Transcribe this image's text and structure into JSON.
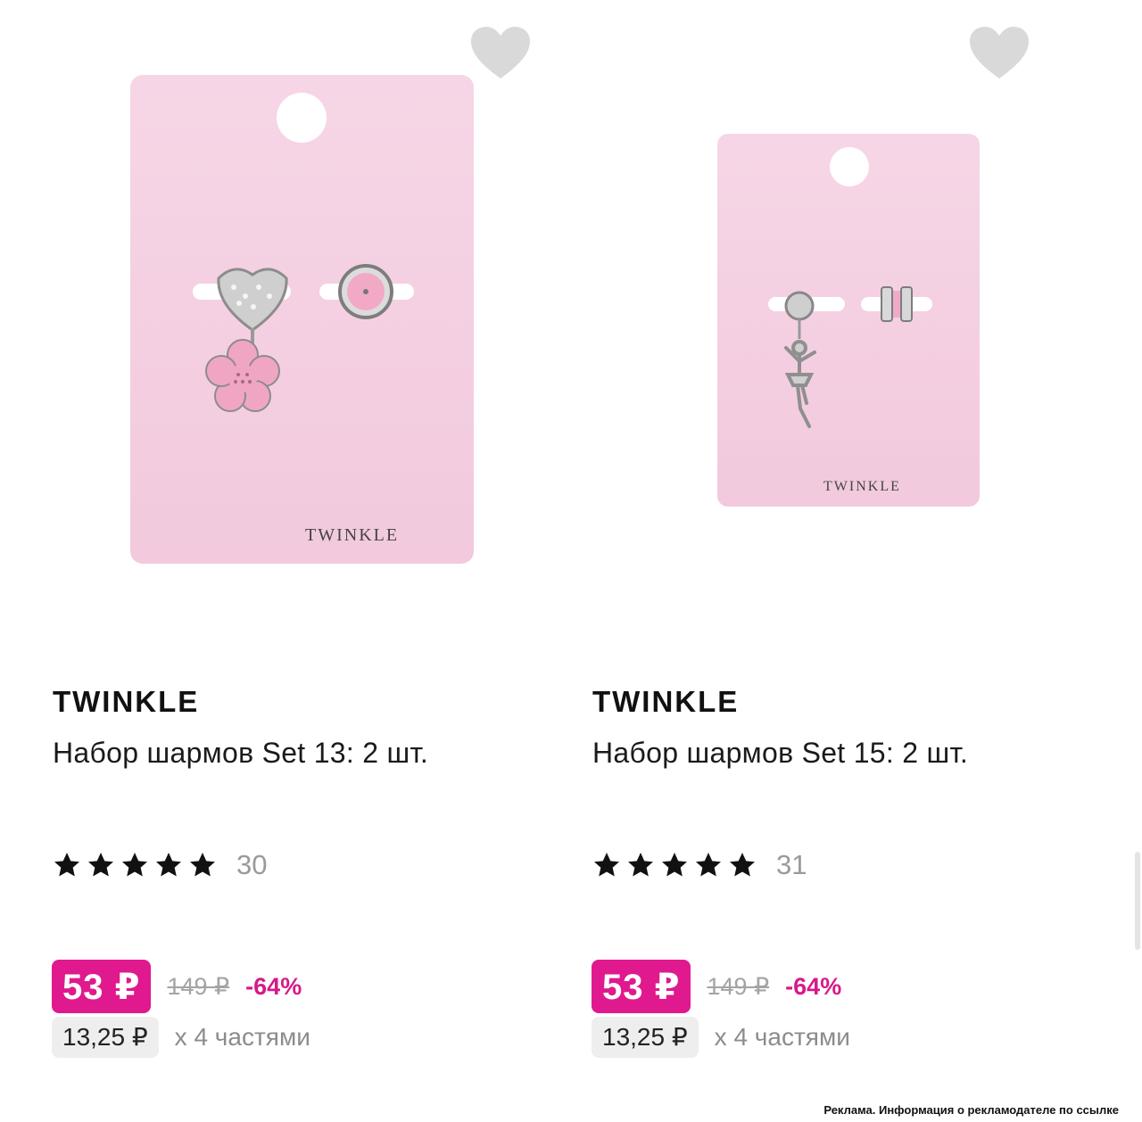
{
  "products": [
    {
      "brand": "TWINKLE",
      "title": "Набор шармов Set 13: 2 шт.",
      "card_logo": "TWINKLE",
      "rating_stars": 5,
      "reviews": "30",
      "price": "53 ₽",
      "old_price": "149 ₽",
      "discount": "-64%",
      "installment_price": "13,25 ₽",
      "installment_text": "х 4 частями"
    },
    {
      "brand": "TWINKLE",
      "title": "Набор шармов Set 15: 2 шт.",
      "card_logo": "TWINKLE",
      "rating_stars": 5,
      "reviews": "31",
      "price": "53 ₽",
      "old_price": "149 ₽",
      "discount": "-64%",
      "installment_price": "13,25 ₽",
      "installment_text": "х 4 частями"
    }
  ],
  "ad_note": "Реклама. Информация о рекламодателе по ссылке",
  "colors": {
    "accent": "#e0198f",
    "discount": "#d6198a",
    "card_pink": "#f5d3e4",
    "heart": "#d9d9d9"
  },
  "icons": {
    "favorite": "heart-icon",
    "rating": "star-icon"
  }
}
